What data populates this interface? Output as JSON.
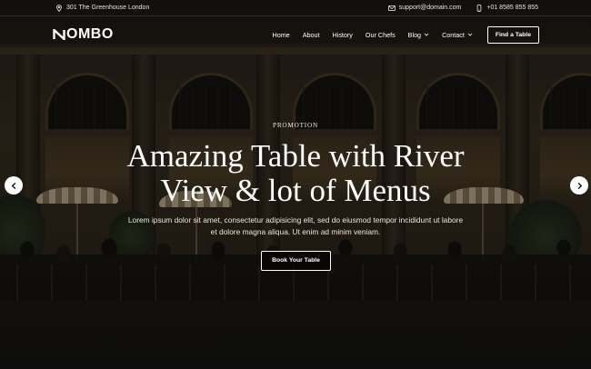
{
  "topbar": {
    "address": "301 The Greenhouse London",
    "email": "support@domain.com",
    "phone": "+01 8585 855 855",
    "icons": {
      "address": "map-pin-icon",
      "email": "envelope-icon",
      "phone": "phone-icon"
    }
  },
  "header": {
    "logo_text": "OMBO",
    "logo_icon": "n-logo-mark-icon",
    "nav": {
      "items": [
        {
          "label": "Home",
          "has_dropdown": false
        },
        {
          "label": "About",
          "has_dropdown": false
        },
        {
          "label": "History",
          "has_dropdown": false
        },
        {
          "label": "Our Chefs",
          "has_dropdown": false
        },
        {
          "label": "Blog",
          "has_dropdown": true
        },
        {
          "label": "Contact",
          "has_dropdown": true
        }
      ]
    },
    "cta_label": "Find a Table"
  },
  "hero": {
    "eyebrow": "PROMOTION",
    "headline_line1": "Amazing Table with River",
    "headline_line2": "View & lot of Menus",
    "lede_line1": "Lorem ipsum dolor sit amet, consectetur adipisicing elit, sed do eiusmod tempor incididunt ut labore",
    "lede_line2": "et dolore magna aliqua. Ut enim ad minim veniam.",
    "button_label": "Book Your Table",
    "background_description_icon": "restaurant-terrace-night-photo"
  },
  "slider": {
    "prev_icon": "chevron-left-icon",
    "next_icon": "chevron-right-icon"
  },
  "colors": {
    "overlay": "#080706",
    "text": "#ffffff",
    "arrow_bg": "#ffffff",
    "arrow_fg": "#1a1a1a"
  }
}
